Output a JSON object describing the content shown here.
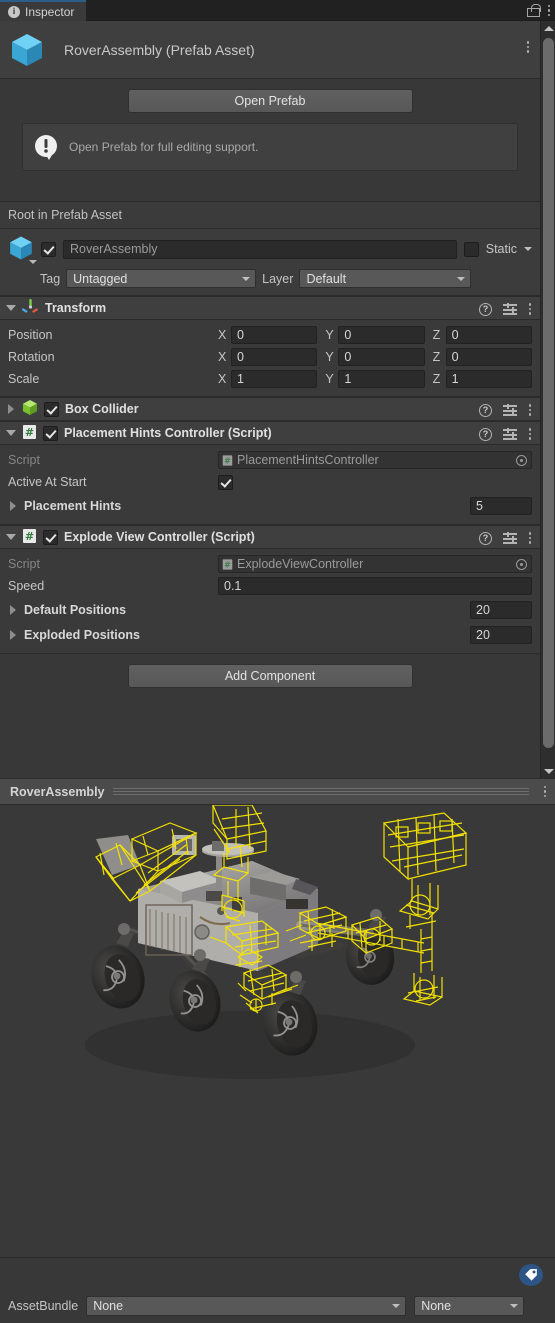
{
  "window": {
    "tab_label": "Inspector",
    "tab_icon": "info-icon",
    "lock_icon": "lock-open-icon",
    "menu_icon": "kebab-menu-icon"
  },
  "asset_header": {
    "icon": "prefab-cube-icon",
    "title": "RoverAssembly (Prefab Asset)",
    "menu_icon": "kebab-menu-icon"
  },
  "prefab_actions": {
    "open_prefab_label": "Open Prefab",
    "help_icon": "warning-icon",
    "help_text": "Open Prefab for full editing support."
  },
  "root_section": {
    "label": "Root in Prefab Asset"
  },
  "game_object": {
    "icon": "prefab-cube-icon",
    "enabled": true,
    "name": "RoverAssembly",
    "static_label": "Static",
    "static_checked": false,
    "tag_label": "Tag",
    "tag_value": "Untagged",
    "layer_label": "Layer",
    "layer_value": "Default"
  },
  "components": [
    {
      "id": "transform",
      "title": "Transform",
      "icon": "transform-axis-icon",
      "expanded": true,
      "has_checkbox": false,
      "rows": [
        {
          "label": "Position",
          "axes": [
            "X",
            "Y",
            "Z"
          ],
          "values": [
            "0",
            "0",
            "0"
          ]
        },
        {
          "label": "Rotation",
          "axes": [
            "X",
            "Y",
            "Z"
          ],
          "values": [
            "0",
            "0",
            "0"
          ]
        },
        {
          "label": "Scale",
          "axes": [
            "X",
            "Y",
            "Z"
          ],
          "values": [
            "1",
            "1",
            "1"
          ]
        }
      ]
    },
    {
      "id": "box-collider",
      "title": "Box Collider",
      "icon": "box-collider-icon",
      "expanded": false,
      "has_checkbox": true,
      "enabled": true
    },
    {
      "id": "placement-hints-controller",
      "title": "Placement Hints Controller (Script)",
      "icon": "script-icon",
      "expanded": true,
      "has_checkbox": true,
      "enabled": true,
      "script_label": "Script",
      "script_value": "PlacementHintsController",
      "toggle_label": "Active At Start",
      "toggle_value": true,
      "array_label": "Placement Hints",
      "array_size": "5"
    },
    {
      "id": "explode-view-controller",
      "title": "Explode View Controller (Script)",
      "icon": "script-icon",
      "expanded": true,
      "has_checkbox": true,
      "enabled": true,
      "script_label": "Script",
      "script_value": "ExplodeViewController",
      "speed_label": "Speed",
      "speed_value": "0.1",
      "default_positions_label": "Default Positions",
      "default_positions_size": "20",
      "exploded_positions_label": "Exploded Positions",
      "exploded_positions_size": "20"
    }
  ],
  "add_component": {
    "label": "Add Component"
  },
  "preview": {
    "title": "RoverAssembly",
    "menu_icon": "kebab-menu-icon",
    "model": "mars-rover-prefab-preview",
    "highlight_color": "#f5e400"
  },
  "asset_bundle": {
    "badge_icon": "asset-bundle-tag-icon",
    "label": "AssetBundle",
    "bundle_value": "None",
    "variant_value": "None"
  },
  "scrollbar": {
    "up_icon": "scroll-up-arrow-icon",
    "down_icon": "scroll-down-arrow-icon"
  },
  "colors": {
    "accent_tab": "#2c5d87",
    "prefab_blue": "#4ec3f0",
    "collider_green": "#8fd13f",
    "script_green": "#3a8f4a",
    "badge_blue": "#2d5486",
    "panel_bg": "#383838",
    "header_bg": "#3f3f3f"
  }
}
